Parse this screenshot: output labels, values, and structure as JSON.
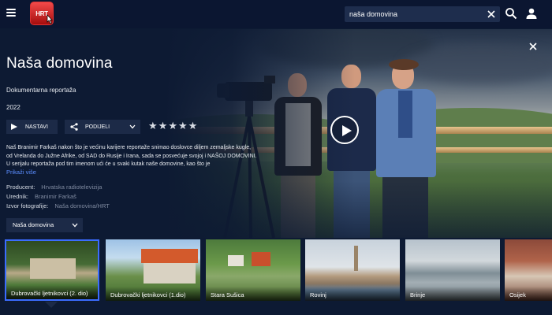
{
  "header": {
    "logo_text": "HRT",
    "search": {
      "value": "naša domovina"
    }
  },
  "show": {
    "title": "Naša domovina",
    "genre": "Dokumentarna reportaža",
    "year": "2022",
    "actions": {
      "play_label": "NASTAVI",
      "share_label": "PODIJELI"
    },
    "rating": {
      "stars": 5,
      "glyph": "★"
    },
    "description": "Naš Branimir Farkaš nakon što je većinu karijere reportaže snimao doslovce diljem zemaljske kugle, od Vrelanda do Južne Afrike, od SAD do Rusije i Irana, sada se posvećuje svojoj i NAŠOJ DOMOVINI. U serijalu reportaža pod tim imenom ući će u svaki kutak naše domovine, kao što je",
    "more_label": "Prikaži više",
    "credits": [
      {
        "label": "Producent:",
        "value": "Hrvatska radiotelevizija"
      },
      {
        "label": "Urednik:",
        "value": "Branimir Farkaš"
      },
      {
        "label": "Izvor fotografije:",
        "value": "Naša domovina/HRT"
      }
    ],
    "season_select": "Naša domovina"
  },
  "episodes": [
    {
      "title": "Dubrovački ljetnikovci (2. dio)",
      "selected": true
    },
    {
      "title": "Dubrovački ljetnikovci (1.dio)",
      "selected": false
    },
    {
      "title": "Stara Sušica",
      "selected": false
    },
    {
      "title": "Rovinj",
      "selected": false
    },
    {
      "title": "Brinje",
      "selected": false
    },
    {
      "title": "Osijek",
      "selected": false
    }
  ],
  "colors": {
    "background": "#0d1a33",
    "accent": "#3b6cff",
    "link": "#5b8dff",
    "button": "#1c2a47",
    "logo": "#d61f1f"
  }
}
